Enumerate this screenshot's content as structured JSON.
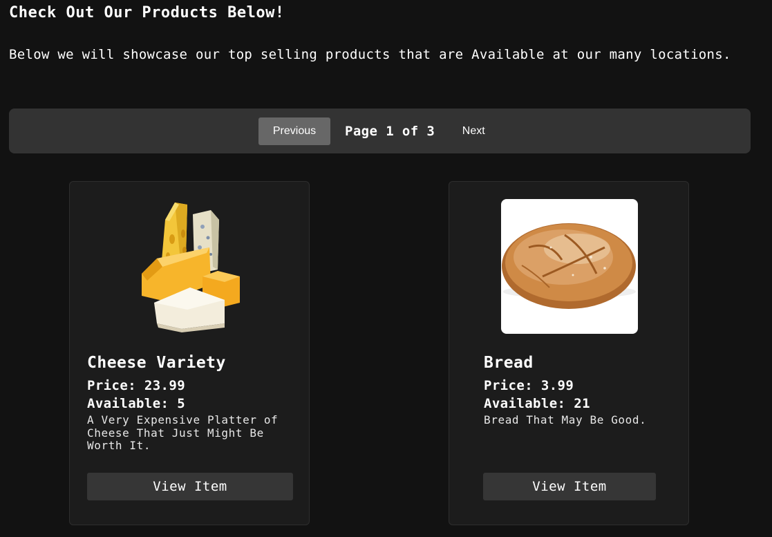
{
  "header": {
    "title": "Check Out Our Products Below!",
    "intro": "Below we will showcase our top selling products that are Available at our many locations."
  },
  "pagination": {
    "previous_label": "Previous",
    "page_text": "Page 1 of 3",
    "next_label": "Next"
  },
  "products": [
    {
      "name": "Cheese Variety",
      "price_text": "Price: 23.99",
      "available_text": "Available: 5",
      "description": "A Very Expensive Platter of Cheese That Just Might Be Worth It.",
      "button_label": "View Item",
      "image_icon": "cheese-image"
    },
    {
      "name": "Bread",
      "price_text": "Price: 3.99",
      "available_text": "Available: 21",
      "description": "Bread That May Be Good.",
      "button_label": "View Item",
      "image_icon": "bread-image"
    }
  ],
  "colors": {
    "background": "#121212",
    "pager_background": "#333333",
    "previous_button": "#676767",
    "card_background": "#1c1c1c",
    "view_button": "#363636",
    "text": "#ffffff"
  }
}
